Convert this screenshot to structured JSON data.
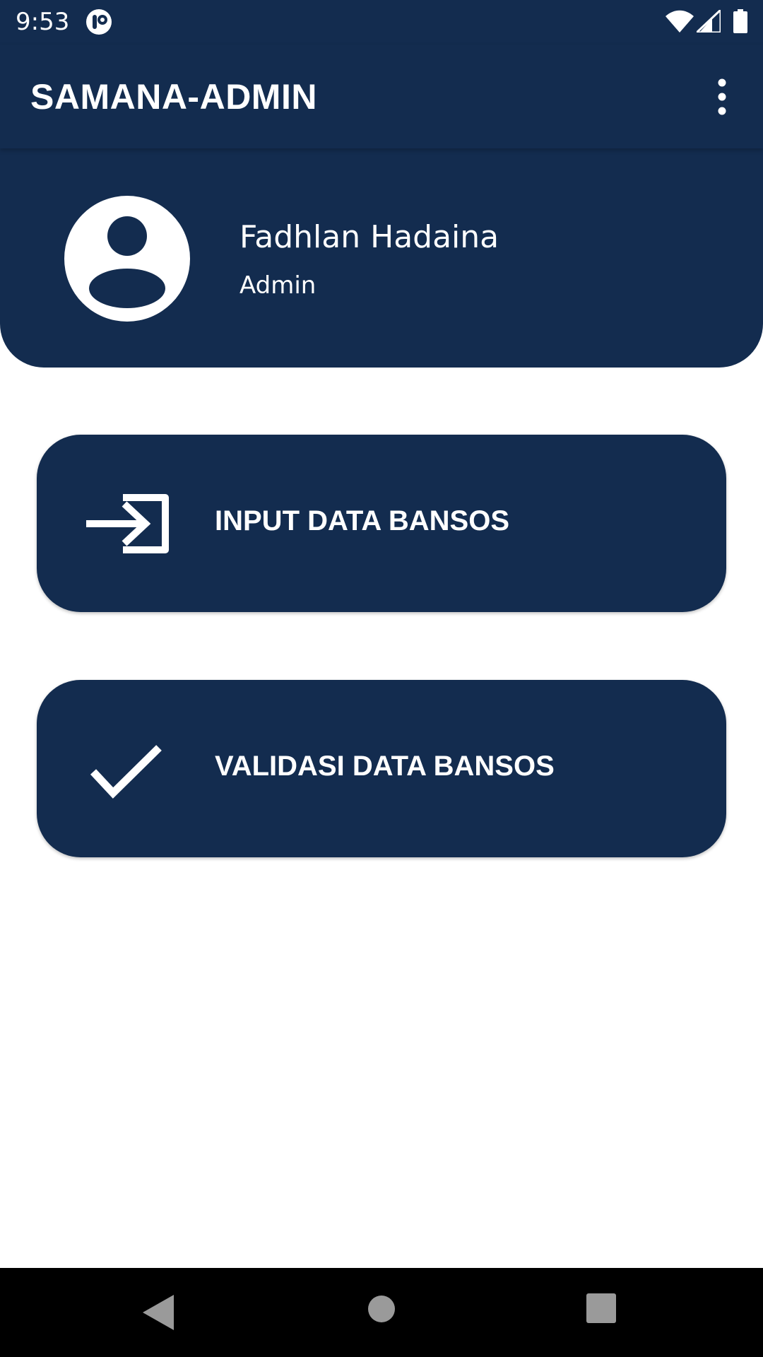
{
  "status_bar": {
    "time": "9:53",
    "icons": [
      "notification-app-icon",
      "wifi-icon",
      "cell-signal-icon",
      "battery-icon"
    ]
  },
  "app_bar": {
    "title": "SAMANA-ADMIN",
    "overflow_icon": "more-vert-icon"
  },
  "profile": {
    "name": "Fadhlan Hadaina",
    "role": "Admin",
    "avatar_icon": "account-circle-icon"
  },
  "actions": [
    {
      "label": "INPUT DATA BANSOS",
      "icon": "login-arrow-icon"
    },
    {
      "label": "VALIDASI DATA BANSOS",
      "icon": "check-icon"
    }
  ],
  "nav_bar": {
    "icons": [
      "back-icon",
      "home-icon",
      "recents-icon"
    ]
  },
  "colors": {
    "primary": "#132c4f",
    "on_primary": "#ffffff",
    "background": "#ffffff",
    "nav_bar": "#000000"
  }
}
